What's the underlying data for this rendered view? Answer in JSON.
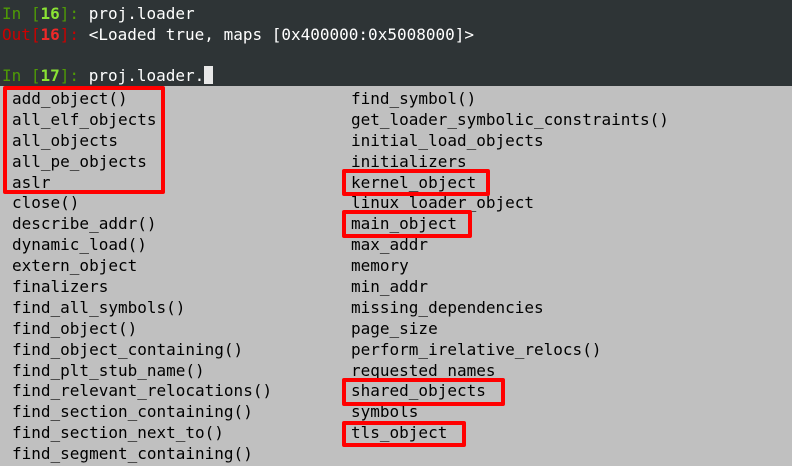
{
  "terminal": {
    "prompt_in_1": "In [",
    "prompt_in_1_num": "16",
    "prompt_in_1_close": "]: ",
    "command_1": "proj.loader",
    "prompt_out": "Out[",
    "prompt_out_num": "16",
    "prompt_out_close": "]: ",
    "output_1": "<Loaded true, maps [0x400000:0x5008000]>",
    "prompt_in_2": "In [",
    "prompt_in_2_num": "17",
    "prompt_in_2_close": "]: ",
    "command_2": "proj.loader."
  },
  "completion": {
    "left": [
      "add_object()",
      "all_elf_objects",
      "all_objects",
      "all_pe_objects",
      "aslr",
      "close()",
      "describe_addr()",
      "dynamic_load()",
      "extern_object",
      "finalizers",
      "find_all_symbols()",
      "find_object()",
      "find_object_containing()",
      "find_plt_stub_name()",
      "find_relevant_relocations()",
      "find_section_containing()",
      "find_section_next_to()",
      "find_segment_containing()"
    ],
    "right": [
      "find_symbol()",
      "get_loader_symbolic_constraints()",
      "initial_load_objects",
      "initializers",
      "kernel_object",
      "linux_loader_object",
      "main_object",
      "max_addr",
      "memory",
      "min_addr",
      "missing_dependencies",
      "page_size",
      "perform_irelative_relocs()",
      "requested_names",
      "shared_objects",
      "symbols",
      "tls_object"
    ]
  },
  "colors": {
    "terminal_bg": "#2e3436",
    "popup_bg": "#c0c0c0",
    "highlight": "#ff0000"
  }
}
